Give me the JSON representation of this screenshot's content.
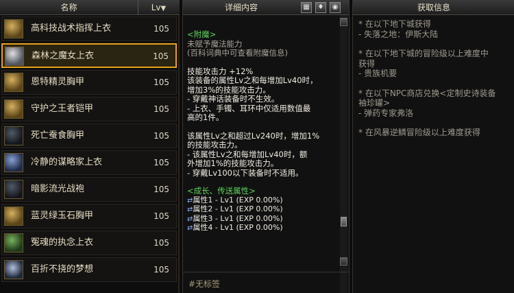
{
  "list": {
    "header_name": "名称",
    "header_lv": "Lv",
    "header_lv_arrow": "▼",
    "items": [
      {
        "name": "高科技战术指挥上衣",
        "lv": "105",
        "thumb": "gold"
      },
      {
        "name": "森林之魔女上衣",
        "lv": "105",
        "thumb": "white",
        "selected": true
      },
      {
        "name": "恩特精灵胸甲",
        "lv": "105",
        "thumb": "gold"
      },
      {
        "name": "守护之王者铠甲",
        "lv": "105",
        "thumb": "gold"
      },
      {
        "name": "死亡蚕食胸甲",
        "lv": "105",
        "thumb": "dark"
      },
      {
        "name": "冷静的谋略家上衣",
        "lv": "105",
        "thumb": "blue"
      },
      {
        "name": "暗影流光战袍",
        "lv": "105",
        "thumb": "dark"
      },
      {
        "name": "蓝灵绿玉石胸甲",
        "lv": "105",
        "thumb": "gold"
      },
      {
        "name": "冤魂的执念上衣",
        "lv": "105",
        "thumb": "green"
      },
      {
        "name": "百折不挠的梦想",
        "lv": "105",
        "thumb": "bird"
      }
    ]
  },
  "detail": {
    "title": "详细内容",
    "buttons": [
      {
        "icon": "grid-icon",
        "glyph": "▦"
      },
      {
        "icon": "pin-icon",
        "glyph": "♦"
      },
      {
        "icon": "eye-icon",
        "glyph": "◉"
      }
    ],
    "enchant_title": "<附魔>",
    "enchant_line1": "未赋予魔法能力",
    "enchant_line2": "(百科词典中可查看附魔信息)",
    "skill_lines": [
      "技能攻击力 +12%",
      "该装备的属性Lv之和每增加Lv40时，",
      "增加3%的技能攻击力。",
      "- 穿戴神话装备时不生效。",
      "- 上衣、手镯、耳环中仅适用数值最",
      "高的1件。"
    ],
    "extra_lines": [
      "该属性Lv之和超过Lv240时，增加1%",
      "的技能攻击力。",
      "- 该属性Lv之和每增加Lv40时，额",
      "外增加1%的技能攻击力。",
      "- 穿戴Lv100以下装备时不适用。"
    ],
    "growth_title": "<成长、传送属性>",
    "props": [
      "属性1 - Lv1 (EXP 0.00%)",
      "属性2 - Lv1 (EXP 0.00%)",
      "属性3 - Lv1 (EXP 0.00%)",
      "属性4 - Lv1 (EXP 0.00%)"
    ],
    "tag": "#无标签"
  },
  "obtain": {
    "title": "获取信息",
    "sources": [
      [
        "* 在以下地下城获得",
        "- 失落之地：伊斯大陆"
      ],
      [
        "* 在以下地下城的冒险级以上难度中",
        "获得",
        "- 贵族机要"
      ],
      [
        "* 在以下NPC商店兑换<定制史诗装备",
        "袖珍罐>",
        "- 弹药专家弗洛"
      ],
      [
        "* 在风暴逆鳞冒险级以上难度获得"
      ]
    ]
  }
}
